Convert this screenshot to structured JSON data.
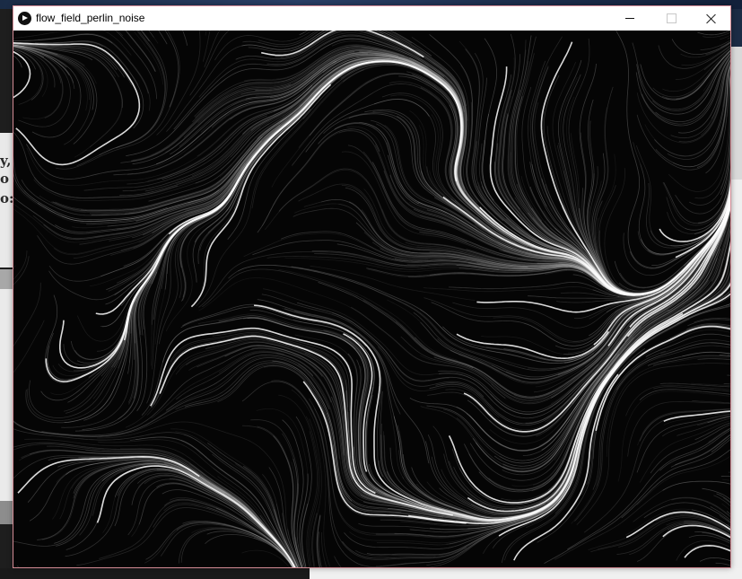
{
  "window": {
    "title": "flow_field_perlin_noise",
    "minimize_label": "Minimize",
    "maximize_label": "Maximize",
    "close_label": "Close"
  },
  "background": {
    "left_snippets": [
      "y,",
      "o",
      "o:"
    ]
  },
  "canvas": {
    "background_color": "#050505",
    "stroke_color": "#ffffff",
    "content": "flow-field"
  },
  "icons": {
    "app": "processing-play-icon",
    "minimize": "minimize-icon",
    "maximize": "maximize-icon",
    "close": "close-icon"
  }
}
